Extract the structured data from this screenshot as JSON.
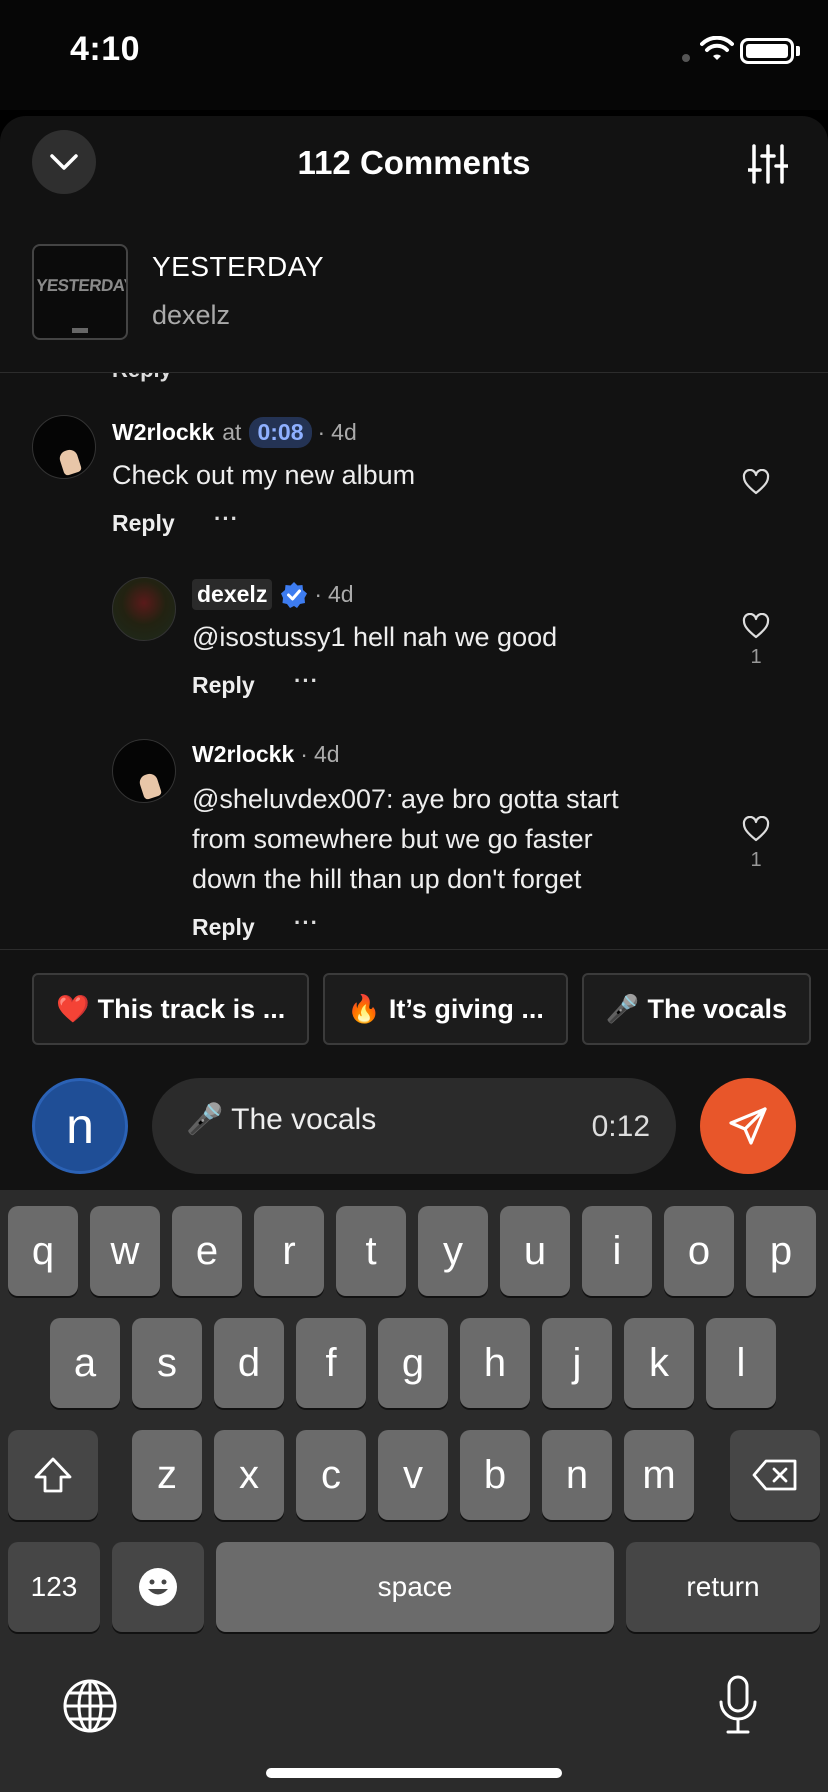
{
  "status_bar": {
    "time": "4:10"
  },
  "sheet": {
    "title": "112 Comments",
    "track": {
      "title": "YESTERDAY",
      "artist": "dexelz",
      "art_text": "YESTERDAY"
    }
  },
  "comments": [
    {
      "user": "W2rlockk",
      "at_label": "at",
      "timestamp": "0:08",
      "age": "4d",
      "text": "Check out my new album",
      "reply_label": "Reply",
      "more": "···",
      "likes": ""
    },
    {
      "user": "dexelz",
      "verified": true,
      "age": "4d",
      "text": "@isostussy1 hell nah we good",
      "reply_label": "Reply",
      "more": "···",
      "likes": "1"
    },
    {
      "user": "W2rlockk",
      "age": "4d",
      "text_lines": [
        "@sheluvdex007: aye bro gotta start",
        "from somewhere but we go faster",
        "down the hill than up don't forget"
      ],
      "reply_label": "Reply",
      "more": "···",
      "likes": "1"
    }
  ],
  "cut_reply": "Reply",
  "chips": [
    {
      "emoji": "❤️",
      "label": "This track is ..."
    },
    {
      "emoji": "🔥",
      "label": "It’s giving ..."
    },
    {
      "emoji": "🎤",
      "label": "The vocals"
    }
  ],
  "composer": {
    "avatar_letter": "n",
    "text": "🎤 The vocals",
    "time": "0:12"
  },
  "keyboard": {
    "row1": [
      "q",
      "w",
      "e",
      "r",
      "t",
      "y",
      "u",
      "i",
      "o",
      "p"
    ],
    "row2": [
      "a",
      "s",
      "d",
      "f",
      "g",
      "h",
      "j",
      "k",
      "l"
    ],
    "row3": [
      "z",
      "x",
      "c",
      "v",
      "b",
      "n",
      "m"
    ],
    "numbers": "123",
    "space": "space",
    "return": "return"
  },
  "colors": {
    "accent_send": "#e8562a",
    "avatar_blue": "#1f4e96",
    "timestamp_text": "#8fb0ff"
  }
}
